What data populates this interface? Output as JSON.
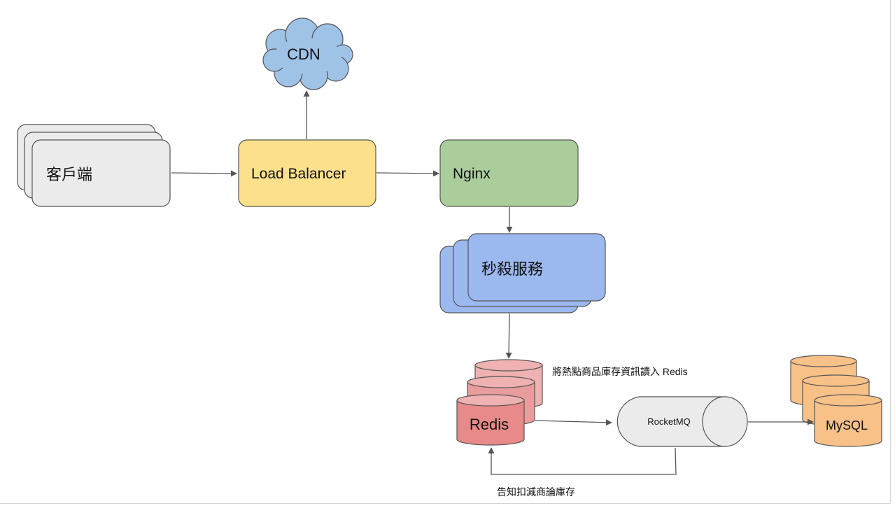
{
  "nodes": {
    "client": {
      "label": "客戶端"
    },
    "load_balancer": {
      "label": "Load Balancer"
    },
    "cdn": {
      "label": "CDN"
    },
    "nginx": {
      "label": "Nginx"
    },
    "seckill_service": {
      "label": "秒殺服務"
    },
    "redis": {
      "label": "Redis"
    },
    "rocketmq": {
      "label": "RocketMQ"
    },
    "mysql": {
      "label": "MySQL"
    }
  },
  "annotations": {
    "redis_note": "將熱點商品庫存資訊讀入 Redis",
    "feedback_note": "告知扣減商論庫存"
  },
  "colors": {
    "client": "#ebebeb",
    "load_balancer": "#fde08b",
    "cdn": "#9fc2e7",
    "nginx": "#a9cd9b",
    "seckill_service": "#9bb8ef",
    "redis": "#e88a89",
    "redis_back": "#efb1b1",
    "rocketmq": "#ebebeb",
    "mysql": "#f8c188",
    "stroke": "#555555"
  }
}
